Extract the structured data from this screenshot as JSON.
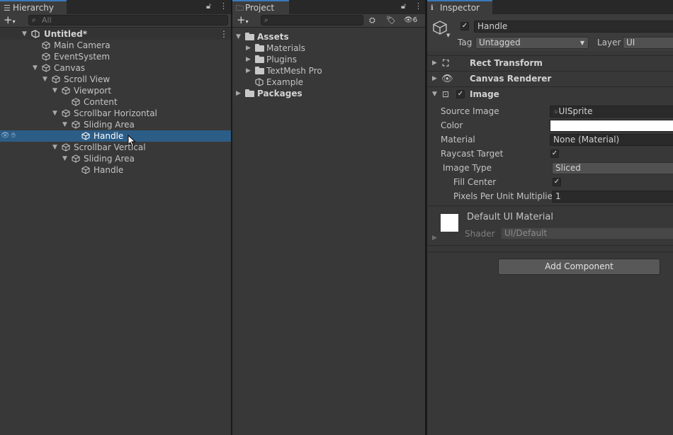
{
  "hierarchy": {
    "tab_label": "Hierarchy",
    "search_placeholder": "All",
    "items": [
      {
        "label": "Untitled*"
      },
      {
        "label": "Main Camera"
      },
      {
        "label": "EventSystem"
      },
      {
        "label": "Canvas"
      },
      {
        "label": "Scroll View"
      },
      {
        "label": "Viewport"
      },
      {
        "label": "Content"
      },
      {
        "label": "Scrollbar Horizontal"
      },
      {
        "label": "Sliding Area"
      },
      {
        "label": "Handle"
      },
      {
        "label": "Scrollbar Vertical"
      },
      {
        "label": "Sliding Area"
      },
      {
        "label": "Handle"
      }
    ]
  },
  "project": {
    "tab_label": "Project",
    "search_placeholder": "",
    "hidden_count": "6",
    "items": [
      {
        "label": "Assets"
      },
      {
        "label": "Materials"
      },
      {
        "label": "Plugins"
      },
      {
        "label": "TextMesh Pro"
      },
      {
        "label": "Example"
      },
      {
        "label": "Packages"
      }
    ]
  },
  "inspector": {
    "tab_label": "Inspector",
    "object_name": "Handle",
    "tag_label": "Tag",
    "tag_value": "Untagged",
    "layer_label": "Layer",
    "layer_value": "UI",
    "components": {
      "rect_transform": "Rect Transform",
      "canvas_renderer": "Canvas Renderer",
      "image": "Image"
    },
    "image_props": {
      "source_image_label": "Source Image",
      "source_image_value": "UISprite",
      "color_label": "Color",
      "material_label": "Material",
      "material_value": "None (Material)",
      "raycast_label": "Raycast Target",
      "image_type_label": "Image Type",
      "image_type_value": "Sliced",
      "fill_center_label": "Fill Center",
      "ppu_label": "Pixels Per Unit Multiplier",
      "ppu_value": "1"
    },
    "material_section": {
      "name": "Default UI Material",
      "shader_label": "Shader",
      "shader_value": "UI/Default"
    },
    "add_component_label": "Add Component"
  },
  "colors": {
    "accent": "#3a79bb",
    "selection": "#2c5d87",
    "panel_bg": "#383838"
  }
}
